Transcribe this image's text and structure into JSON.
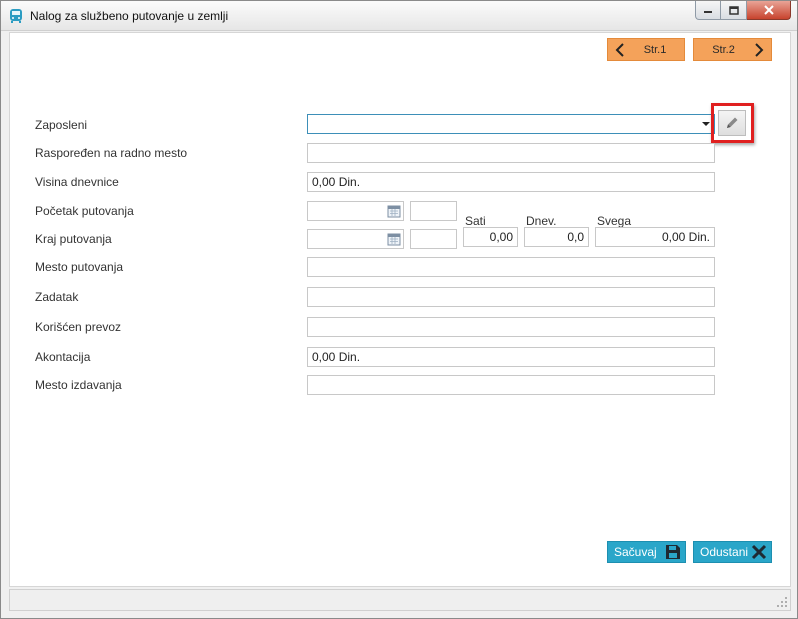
{
  "window": {
    "title": "Nalog za službeno putovanje u zemlji",
    "icons": {
      "app": "bus-icon",
      "minimize": "minimize-icon",
      "maximize": "maximize-icon",
      "close": "close-icon"
    }
  },
  "nav": {
    "prev_label": "Str.1",
    "next_label": "Str.2",
    "color": "#f4a25a"
  },
  "form": {
    "zaposleni": {
      "label": "Zaposleni",
      "value": ""
    },
    "radno_mesto": {
      "label": "Raspoređen na radno mesto",
      "value": ""
    },
    "dnevnica": {
      "label": "Visina dnevnice",
      "value": "0,00 Din."
    },
    "pocetak": {
      "label": "Početak putovanja",
      "date": "",
      "time": ""
    },
    "kraj": {
      "label": "Kraj putovanja",
      "date": "",
      "time": ""
    },
    "totals": {
      "sati_label": "Sati",
      "sati_value": "0,00",
      "dnev_label": "Dnev.",
      "dnev_value": "0,0",
      "svega_label": "Svega",
      "svega_value": "0,00 Din."
    },
    "mesto_putovanja": {
      "label": "Mesto putovanja",
      "value": ""
    },
    "zadatak": {
      "label": "Zadatak",
      "value": ""
    },
    "prevoz": {
      "label": "Korišćen prevoz",
      "value": ""
    },
    "akontacija": {
      "label": "Akontacija",
      "value": "0,00 Din."
    },
    "mesto_izdavanja": {
      "label": "Mesto izdavanja",
      "value": ""
    }
  },
  "actions": {
    "save_label": "Sačuvaj",
    "cancel_label": "Odustani",
    "color": "#2aa6c9"
  },
  "highlight_color": "#e02020"
}
